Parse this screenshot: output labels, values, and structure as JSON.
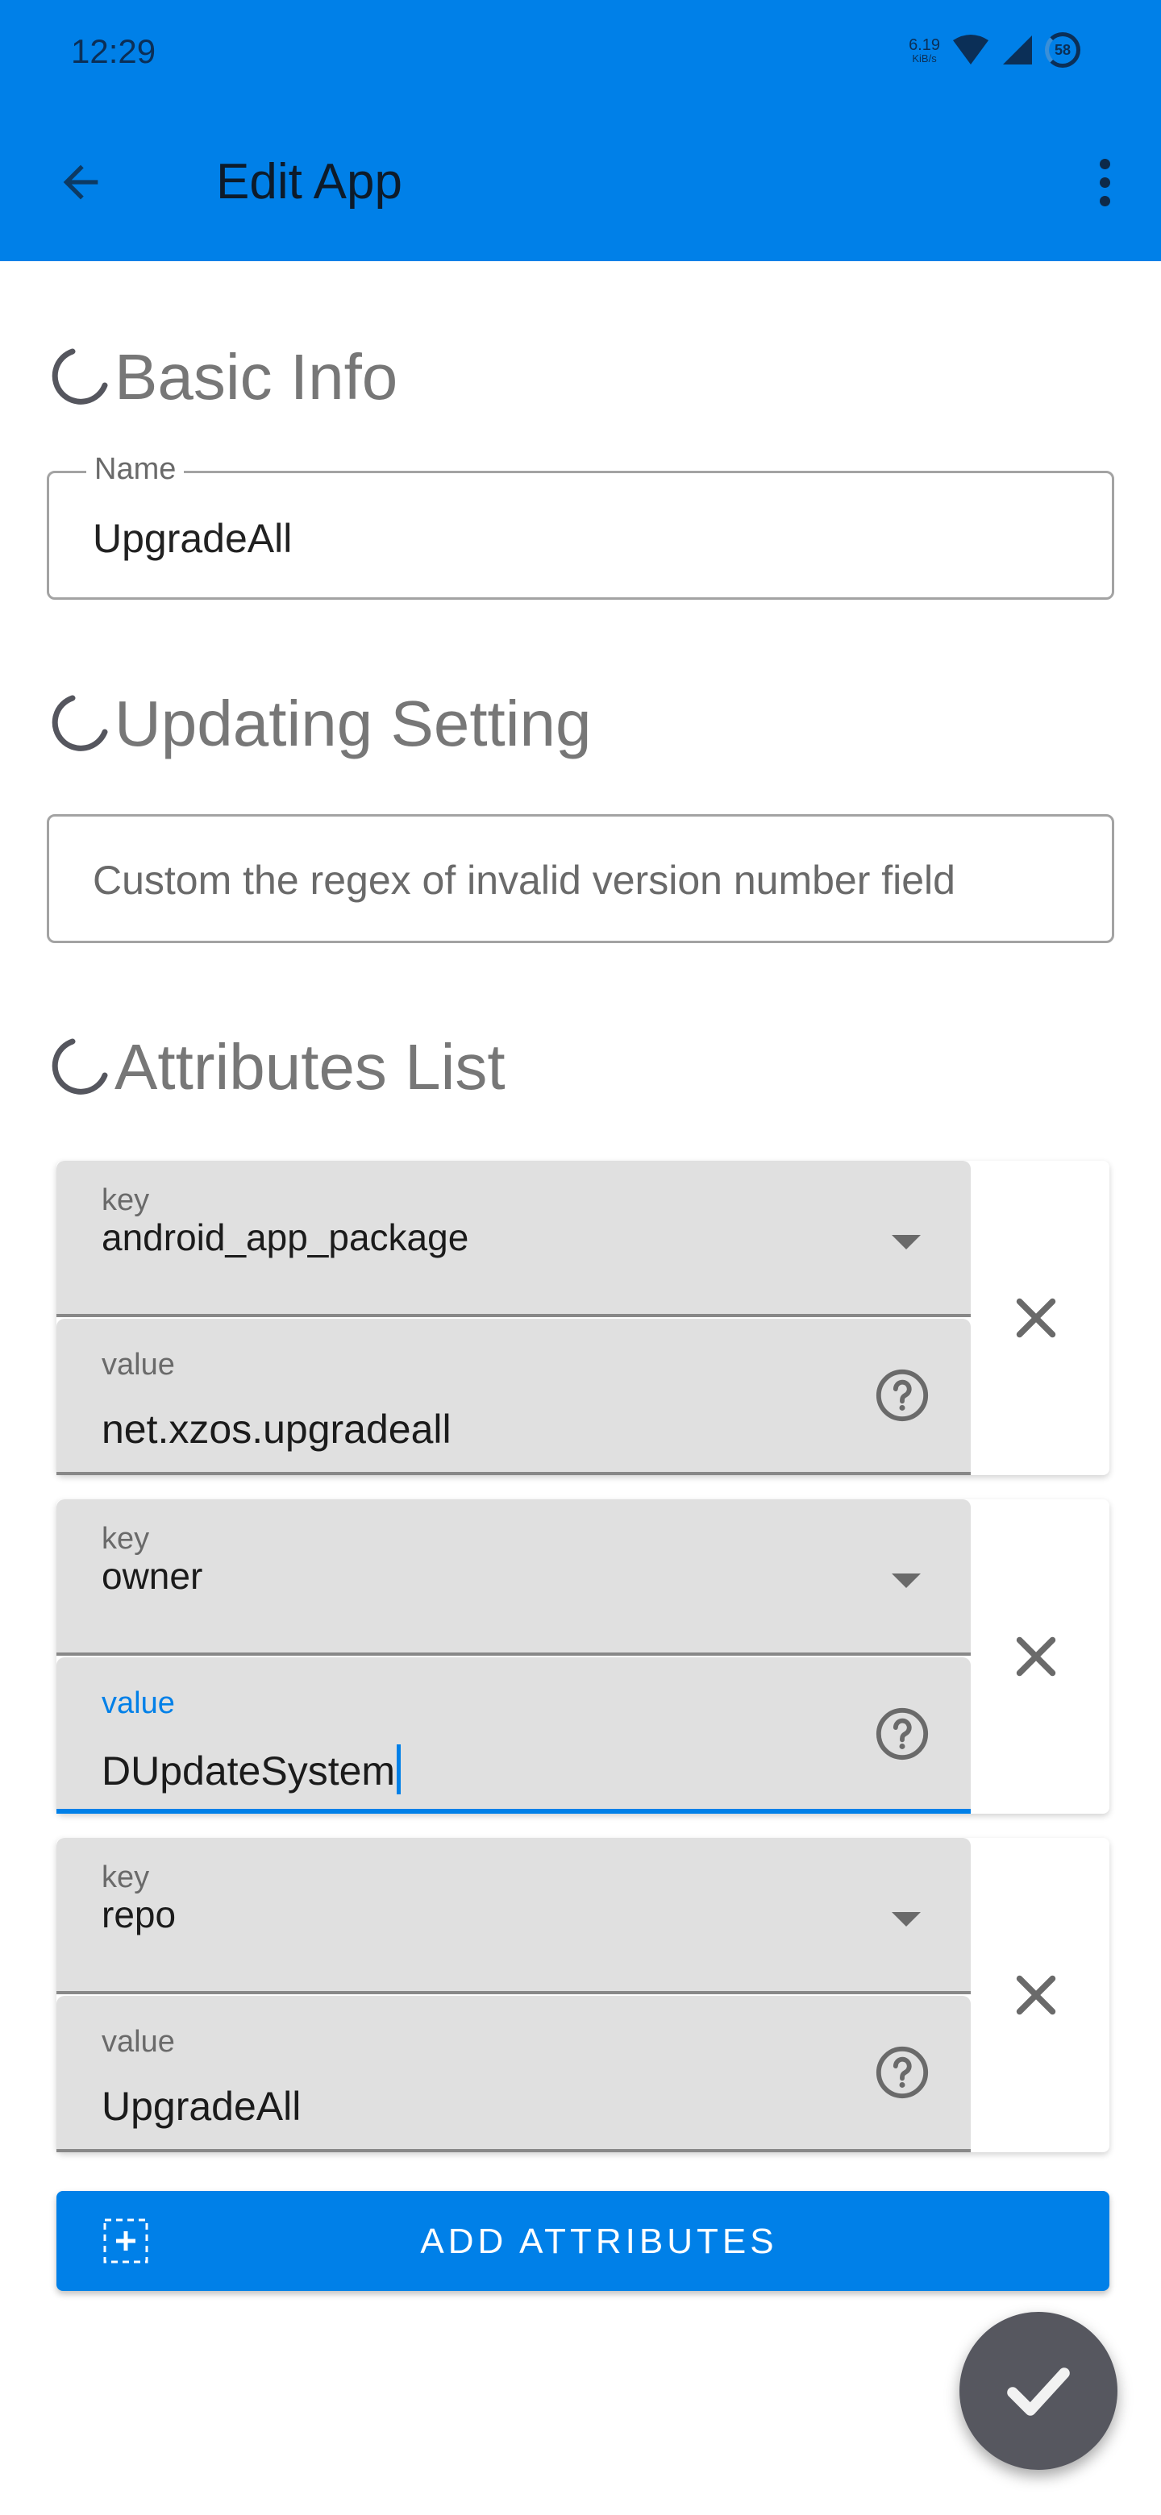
{
  "status_bar": {
    "time": "12:29",
    "net_speed_value": "6.19",
    "net_speed_unit": "KiB/s",
    "battery_level": "58",
    "icons": [
      "wifi-icon",
      "cell-signal-icon",
      "battery-icon"
    ]
  },
  "app_bar": {
    "title": "Edit App",
    "back_icon": "arrow-back-icon",
    "menu_icon": "more-vert-icon"
  },
  "colors": {
    "primary": "#0080e8",
    "fab": "#56575f",
    "section_title": "#777777",
    "field_bg": "#e0e0e0"
  },
  "sections": {
    "basic_info": {
      "title": "Basic Info",
      "name_field": {
        "label": "Name",
        "value": "UpgradeAll"
      }
    },
    "updating_setting": {
      "title": "Updating Setting",
      "regex_field": {
        "placeholder": "Custom the regex of invalid version number field"
      }
    },
    "attributes_list": {
      "title": "Attributes List",
      "items": [
        {
          "key_label": "key",
          "key": "android_app_package",
          "value_label": "value",
          "value": "net.xzos.upgradeall",
          "focused": false
        },
        {
          "key_label": "key",
          "key": "owner",
          "value_label": "value",
          "value": "DUpdateSystem",
          "focused": true
        },
        {
          "key_label": "key",
          "key": "repo",
          "value_label": "value",
          "value": "UpgradeAll",
          "focused": false
        }
      ],
      "add_button_label": "ADD ATTRIBUTES"
    }
  },
  "fab": {
    "icon": "check-icon"
  }
}
